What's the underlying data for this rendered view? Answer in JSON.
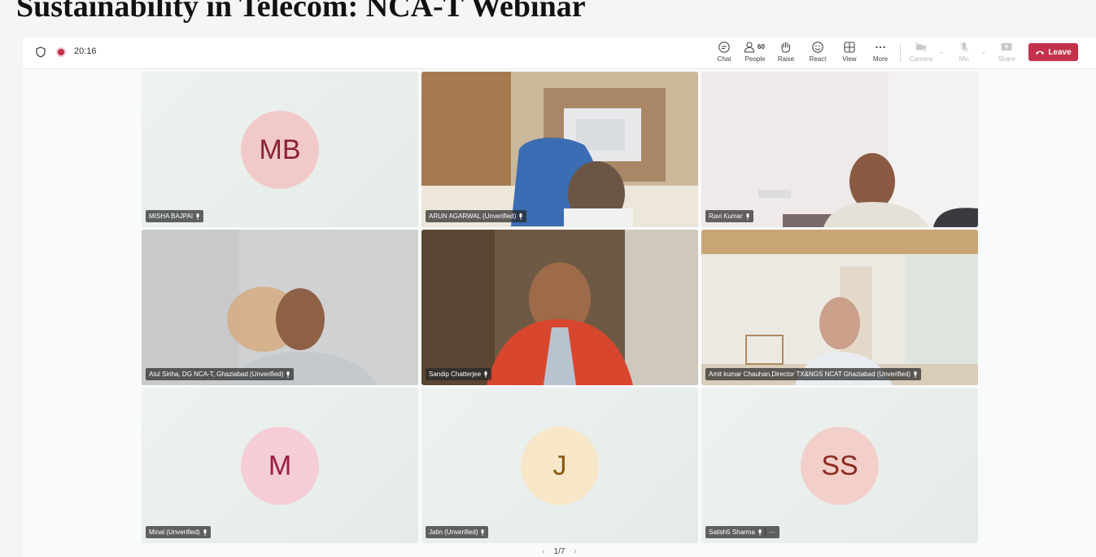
{
  "page_heading": "Sustainability in Telecom: NCA-T Webinar",
  "topbar": {
    "timer": "20:16",
    "buttons": {
      "chat": "Chat",
      "people": "People",
      "people_count": "60",
      "raise": "Raise",
      "react": "React",
      "view": "View",
      "more": "More",
      "camera": "Camera",
      "mic": "Mic",
      "share": "Share"
    },
    "leave": "Leave"
  },
  "tiles": [
    {
      "name": "MISHA BAJPAI",
      "initials": "MB",
      "type": "avatar",
      "avatar_bg": "#f2c9c9",
      "avatar_fg": "#8b2232"
    },
    {
      "name": "ARUN AGARWAL (Unverified)",
      "type": "video"
    },
    {
      "name": "Ravi Kumar",
      "type": "video"
    },
    {
      "name": "Atul Sinha, DG NCA-T, Ghaziabad (Unverified)",
      "type": "video",
      "active": true
    },
    {
      "name": "Sandip Chatterjee",
      "type": "video"
    },
    {
      "name": "Amit kumar Chauhan,Director TX&NGS NCAT Ghaziabad (Unverified)",
      "type": "video"
    },
    {
      "name": "Minal (Unverified)",
      "initials": "M",
      "type": "avatar",
      "avatar_bg": "#f5cdd7",
      "avatar_fg": "#9a1c3c"
    },
    {
      "name": "Jatin (Unverified)",
      "initials": "J",
      "type": "avatar",
      "avatar_bg": "#f7e6c8",
      "avatar_fg": "#8a5a10"
    },
    {
      "name": "Satish5 Sharma",
      "initials": "SS",
      "type": "avatar",
      "avatar_bg": "#f2cfc9",
      "avatar_fg": "#8c2a1f",
      "extra": "···"
    }
  ],
  "pager": {
    "current": "1/7"
  },
  "colors": {
    "accent": "#6264a7",
    "leave": "#c4314b"
  }
}
